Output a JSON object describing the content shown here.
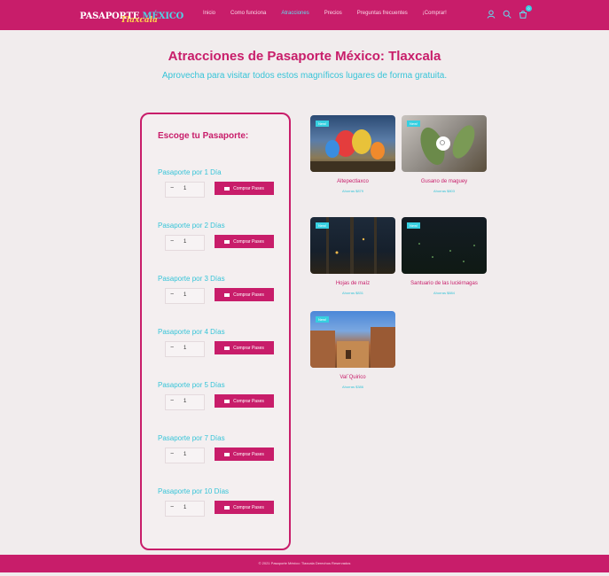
{
  "header": {
    "logo_main": "PASAPORTE",
    "logo_accent": "MÉXICO",
    "logo_sub": "Tlaxcala",
    "nav": [
      {
        "label": "Inicio",
        "active": false
      },
      {
        "label": "Como funciona",
        "active": false
      },
      {
        "label": "Atracciones",
        "active": true
      },
      {
        "label": "Precios",
        "active": false
      },
      {
        "label": "Preguntas frecuentes",
        "active": false
      },
      {
        "label": "¡Comprar!",
        "active": false
      }
    ],
    "icons": [
      "user-icon",
      "search-icon",
      "cart-icon"
    ],
    "cart_count": "0"
  },
  "page": {
    "title": "Atracciones de Pasaporte México: Tlaxcala",
    "subtitle": "Aprovecha para visitar todos estos magníficos lugares de forma gratuita."
  },
  "panel": {
    "title": "Escoge tu Pasaporte:",
    "buy_label": "Comprar Pases",
    "passes": [
      {
        "label": "Pasaporte por 1 Día",
        "qty": "1"
      },
      {
        "label": "Pasaporte por 2 Días",
        "qty": "1"
      },
      {
        "label": "Pasaporte por 3 Días",
        "qty": "1"
      },
      {
        "label": "Pasaporte por 4 Días",
        "qty": "1"
      },
      {
        "label": "Pasaporte por 5 Días",
        "qty": "1"
      },
      {
        "label": "Pasaporte por 7 Días",
        "qty": "1"
      },
      {
        "label": "Pasaporte por 10 Días",
        "qty": "1"
      }
    ]
  },
  "attractions": [
    {
      "badge": "New!",
      "name": "Altepectlaxco",
      "price": "Ahorras $879"
    },
    {
      "badge": "New!",
      "name": "Gusano de maguey",
      "price": "Ahorras $803"
    },
    {
      "badge": "New!",
      "name": "Hojas de maíz",
      "price": "Ahorras $831"
    },
    {
      "badge": "New!",
      "name": "Santuario de las luciérnagas",
      "price": "Ahorras $884"
    },
    {
      "badge": "New!",
      "name": "Val´Quirico",
      "price": "Ahorras $386"
    }
  ],
  "footer": {
    "text": "© 2021 Pasaporte México: Tlaxcala Derechos Reservados"
  },
  "colors": {
    "brand": "#c81d6a",
    "accent": "#36c4d8",
    "background": "#f1eced"
  }
}
